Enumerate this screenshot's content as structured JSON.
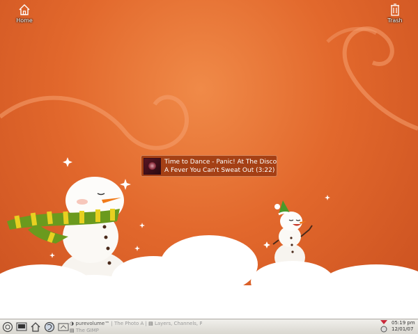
{
  "desktop": {
    "icons": [
      {
        "label": "Home",
        "icon": "home-icon"
      },
      {
        "label": "Trash",
        "icon": "trash-icon"
      }
    ]
  },
  "notification": {
    "line1": "Time to Dance - Panic! At The Disco",
    "line2": "A Fever You Can't Sweat Out (3:22)",
    "icon": "album-art-icon"
  },
  "taskbar": {
    "launchers": [
      "menu-icon",
      "terminal-icon",
      "home-icon",
      "browser-icon",
      "gimp-icon"
    ],
    "tasks": [
      {
        "label": "purevolume™",
        "icon": "browser-icon"
      },
      {
        "label": "The Photo A",
        "icon": ""
      },
      {
        "label": "Layers, Channels, Paths, Ur",
        "icon": "layers-icon"
      },
      {
        "label": "The GIMP",
        "icon": "gimp-icon"
      }
    ],
    "clock": {
      "time": "05:19 pm",
      "date": "12/01/07"
    },
    "tray_icon": "network-icon"
  },
  "colors": {
    "background": "#e2682c",
    "osd_bg": "#96340e",
    "taskbar_bg": "#e6e4de",
    "scarf_green": "#6a9a1e",
    "scarf_yellow": "#e8d020"
  }
}
